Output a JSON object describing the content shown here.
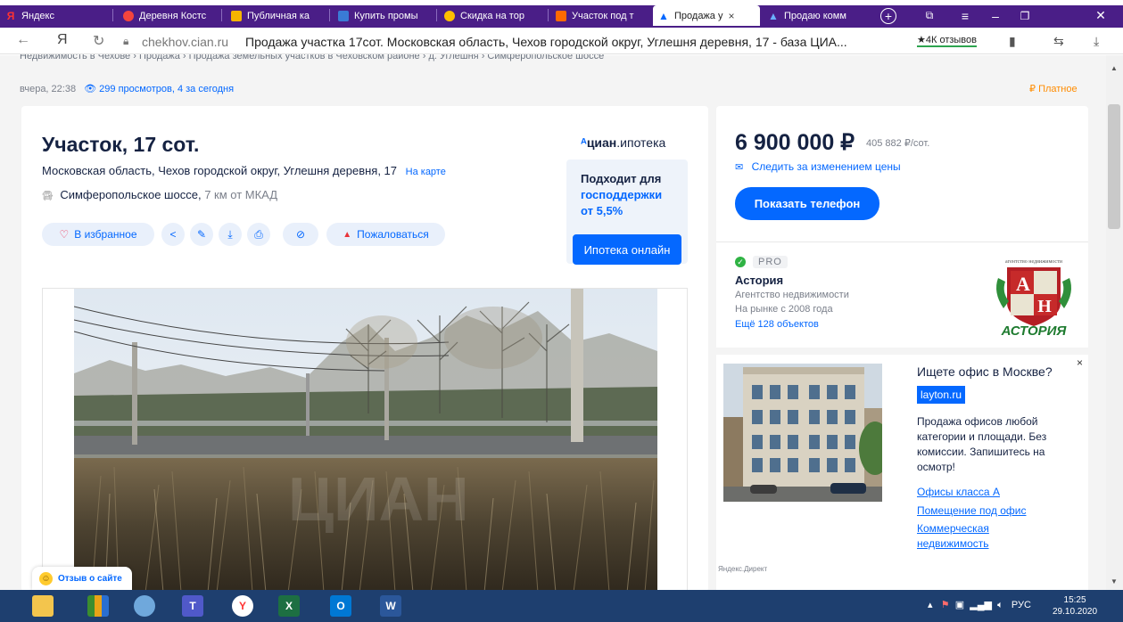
{
  "browser": {
    "tabs": [
      {
        "label": "Яндекс",
        "icon": "yandex-icon",
        "color": "#ff3333"
      },
      {
        "label": "Деревня Костс",
        "icon": "map-pin-icon",
        "color": "#f5453c"
      },
      {
        "label": "Публичная ка",
        "icon": "map-icon",
        "color": "#f5b400"
      },
      {
        "label": "Купить промы",
        "icon": "shop-icon",
        "color": "#3a7bd5"
      },
      {
        "label": "Скидка на тор",
        "icon": "discount-icon",
        "color": "#ffbf00"
      },
      {
        "label": "Участок под т",
        "icon": "house-icon",
        "color": "#ff6a00"
      },
      {
        "label": "Продажа у",
        "icon": "cian-icon",
        "color": "#0468ff",
        "active": true
      },
      {
        "label": "Продаю комм",
        "icon": "cian-icon",
        "color": "#0468ff"
      }
    ],
    "close_glyph": "×",
    "new_tab_glyph": "+",
    "url_domain": "chekhov.cian.ru",
    "page_title": "Продажа участка 17сот. Московская область, Чехов городской округ, Углешня деревня, 17 - база ЦИА...",
    "reviews": "★4К отзывов",
    "yandex_glyph": "Я"
  },
  "page": {
    "breadcrumbs": "Недвижимость в Чехове  ›  Продажа  ›  Продажа земельных участков в Чеховском районе  ›  д. Углешня  ›  Симферопольское шоссе",
    "published": "вчера, 22:38",
    "views": "299 просмотров, 4 за сегодня",
    "paid": "Платное",
    "paid_glyph": "₽",
    "title": "Участок, 17 сот.",
    "address": "Московская область, Чехов городской округ, Углешня деревня, 17",
    "map_link": "На карте",
    "highway": "Симферопольское шоссе,",
    "distance": "7 км от МКАД",
    "favorites": "В избранное",
    "complain": "Пожаловаться",
    "cian_brand": "циан",
    "cian_suffix": ".ипотека",
    "gov_line1": "Подходит для",
    "gov_line2": "господдержки",
    "gov_line3": "от 5,5%",
    "mortgage_button": "Ипотека онлайн",
    "photo_watermark": "ЦИАН"
  },
  "sidebar": {
    "price": "6 900 000 ₽",
    "price_per": "405 882 ₽/сот.",
    "watch_price": "Следить за изменением цены",
    "show_phone": "Показать телефон",
    "pro_label": "PRO",
    "agency_name": "Астория",
    "agency_type": "Агентство недвижимости",
    "agency_since": "На рынке с 2008 года",
    "agency_objects": "Ещё 128 объектов",
    "agency_logo_top": "агентство недвижимости",
    "agency_logo_letter_a": "А",
    "agency_logo_letter_h": "Н",
    "agency_logo_name": "АСТОРИЯ"
  },
  "ad": {
    "close": "×",
    "title": "Ищете офис в Москве?",
    "domain": "layton.ru",
    "text": "Продажа офисов любой категории и площади. Без комиссии. Запишитесь на осмотр!",
    "links": [
      "Офисы класса А",
      "Помещение под офис",
      "Коммерческая недвижимость"
    ],
    "source": "Яндекс.Директ"
  },
  "feedback": "Отзыв о сайте",
  "taskbar": {
    "tray_lang": "РУС",
    "time": "15:25",
    "date": "29.10.2020",
    "apps": [
      {
        "name": "file-explorer-icon",
        "color": "#f3c54d",
        "glyph": ""
      },
      {
        "name": "stats-app-icon",
        "color": "#e8a317",
        "glyph": ""
      },
      {
        "name": "paint-icon",
        "color": "#6fa8dc",
        "glyph": ""
      },
      {
        "name": "teams-icon",
        "color": "#5059c9",
        "glyph": "T"
      },
      {
        "name": "yandex-browser-icon",
        "color": "#ff3333",
        "glyph": "Y"
      },
      {
        "name": "excel-icon",
        "color": "#1d6f42",
        "glyph": "X"
      },
      {
        "name": "outlook-icon",
        "color": "#0078d4",
        "glyph": "O"
      },
      {
        "name": "word-icon",
        "color": "#2b579a",
        "glyph": "W"
      }
    ]
  },
  "colors": {
    "accent": "#0468ff",
    "tabbar": "#4a1e87",
    "taskbar": "#1e3f6f",
    "paid": "#ff8c00"
  }
}
